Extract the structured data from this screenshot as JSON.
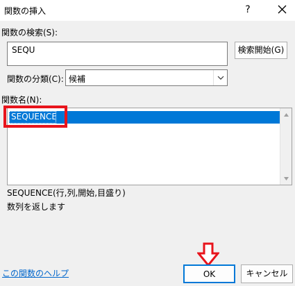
{
  "window": {
    "title": "関数の挿入",
    "help_label": "?"
  },
  "search": {
    "label": "関数の検索(S):",
    "value": "SEQU",
    "button_label": "検索開始(G)"
  },
  "category": {
    "label": "関数の分類(C):",
    "selected": "候補"
  },
  "function_list": {
    "label": "関数名(N):",
    "items": [
      {
        "label": "SEQUENCE",
        "selected": true
      }
    ]
  },
  "description": {
    "signature": "SEQUENCE(行,列,開始,目盛り)",
    "text": "数列を返します"
  },
  "footer": {
    "help_link": "この関数のヘルプ",
    "ok_label": "OK",
    "cancel_label": "キャンセル"
  },
  "colors": {
    "selection": "#0078d7",
    "annotation_red": "#e8141c",
    "link": "#0066cc"
  }
}
